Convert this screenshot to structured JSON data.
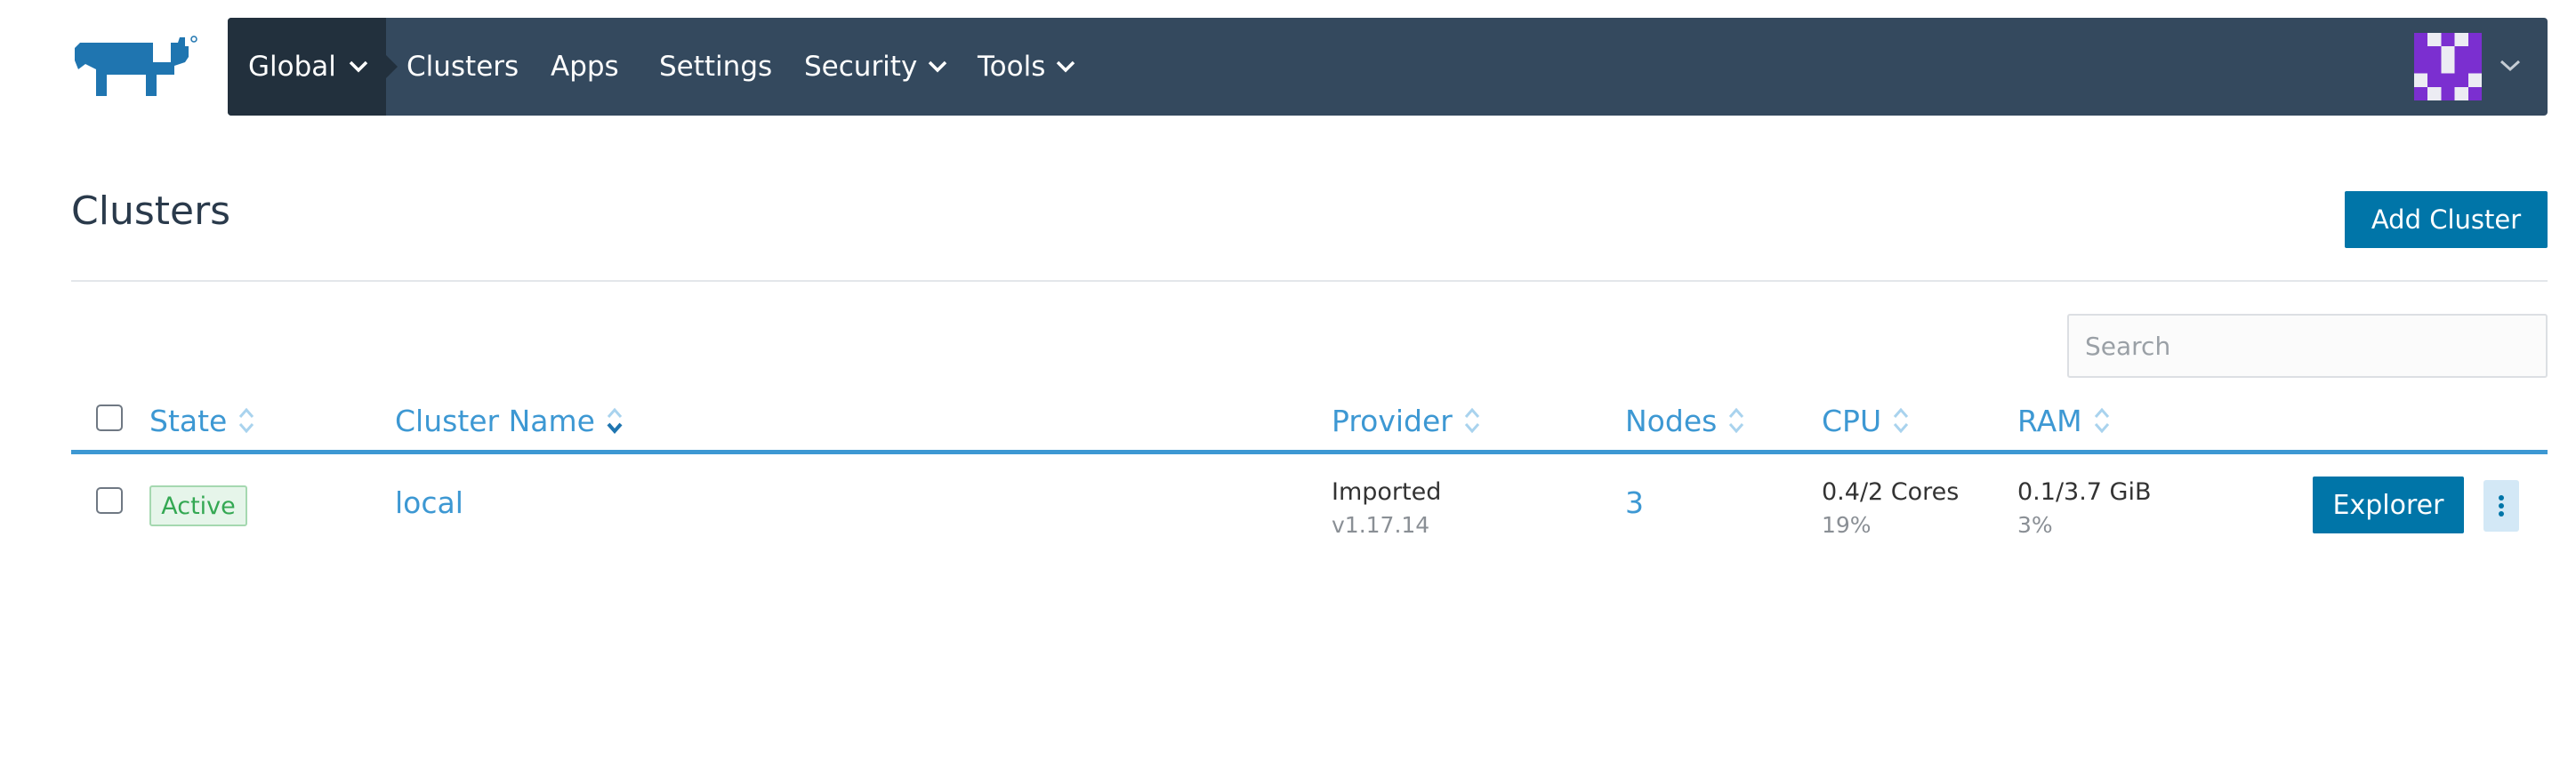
{
  "colors": {
    "navbar": "#34495e",
    "navbar_active": "#22303d",
    "accent": "#3d98d3",
    "primary_button": "#0075a8",
    "active_badge_text": "#34a853",
    "avatar": "#7b2fd0"
  },
  "header": {
    "logo_icon": "rancher-logo-icon",
    "nav": {
      "global": "Global",
      "clusters": "Clusters",
      "apps": "Apps",
      "settings": "Settings",
      "security": "Security",
      "tools": "Tools"
    },
    "user_avatar_icon": "identicon-avatar"
  },
  "page": {
    "title": "Clusters",
    "add_cluster": "Add Cluster",
    "search_placeholder": "Search"
  },
  "table": {
    "columns": {
      "state": "State",
      "name": "Cluster Name",
      "provider": "Provider",
      "nodes": "Nodes",
      "cpu": "CPU",
      "ram": "RAM"
    },
    "rows": [
      {
        "state": "Active",
        "name": "local",
        "provider": "Imported",
        "version": "v1.17.14",
        "nodes": "3",
        "cpu": "0.4/2 Cores",
        "cpu_pct": "19%",
        "ram": "0.1/3.7 GiB",
        "ram_pct": "3%",
        "action": "Explorer"
      }
    ]
  }
}
